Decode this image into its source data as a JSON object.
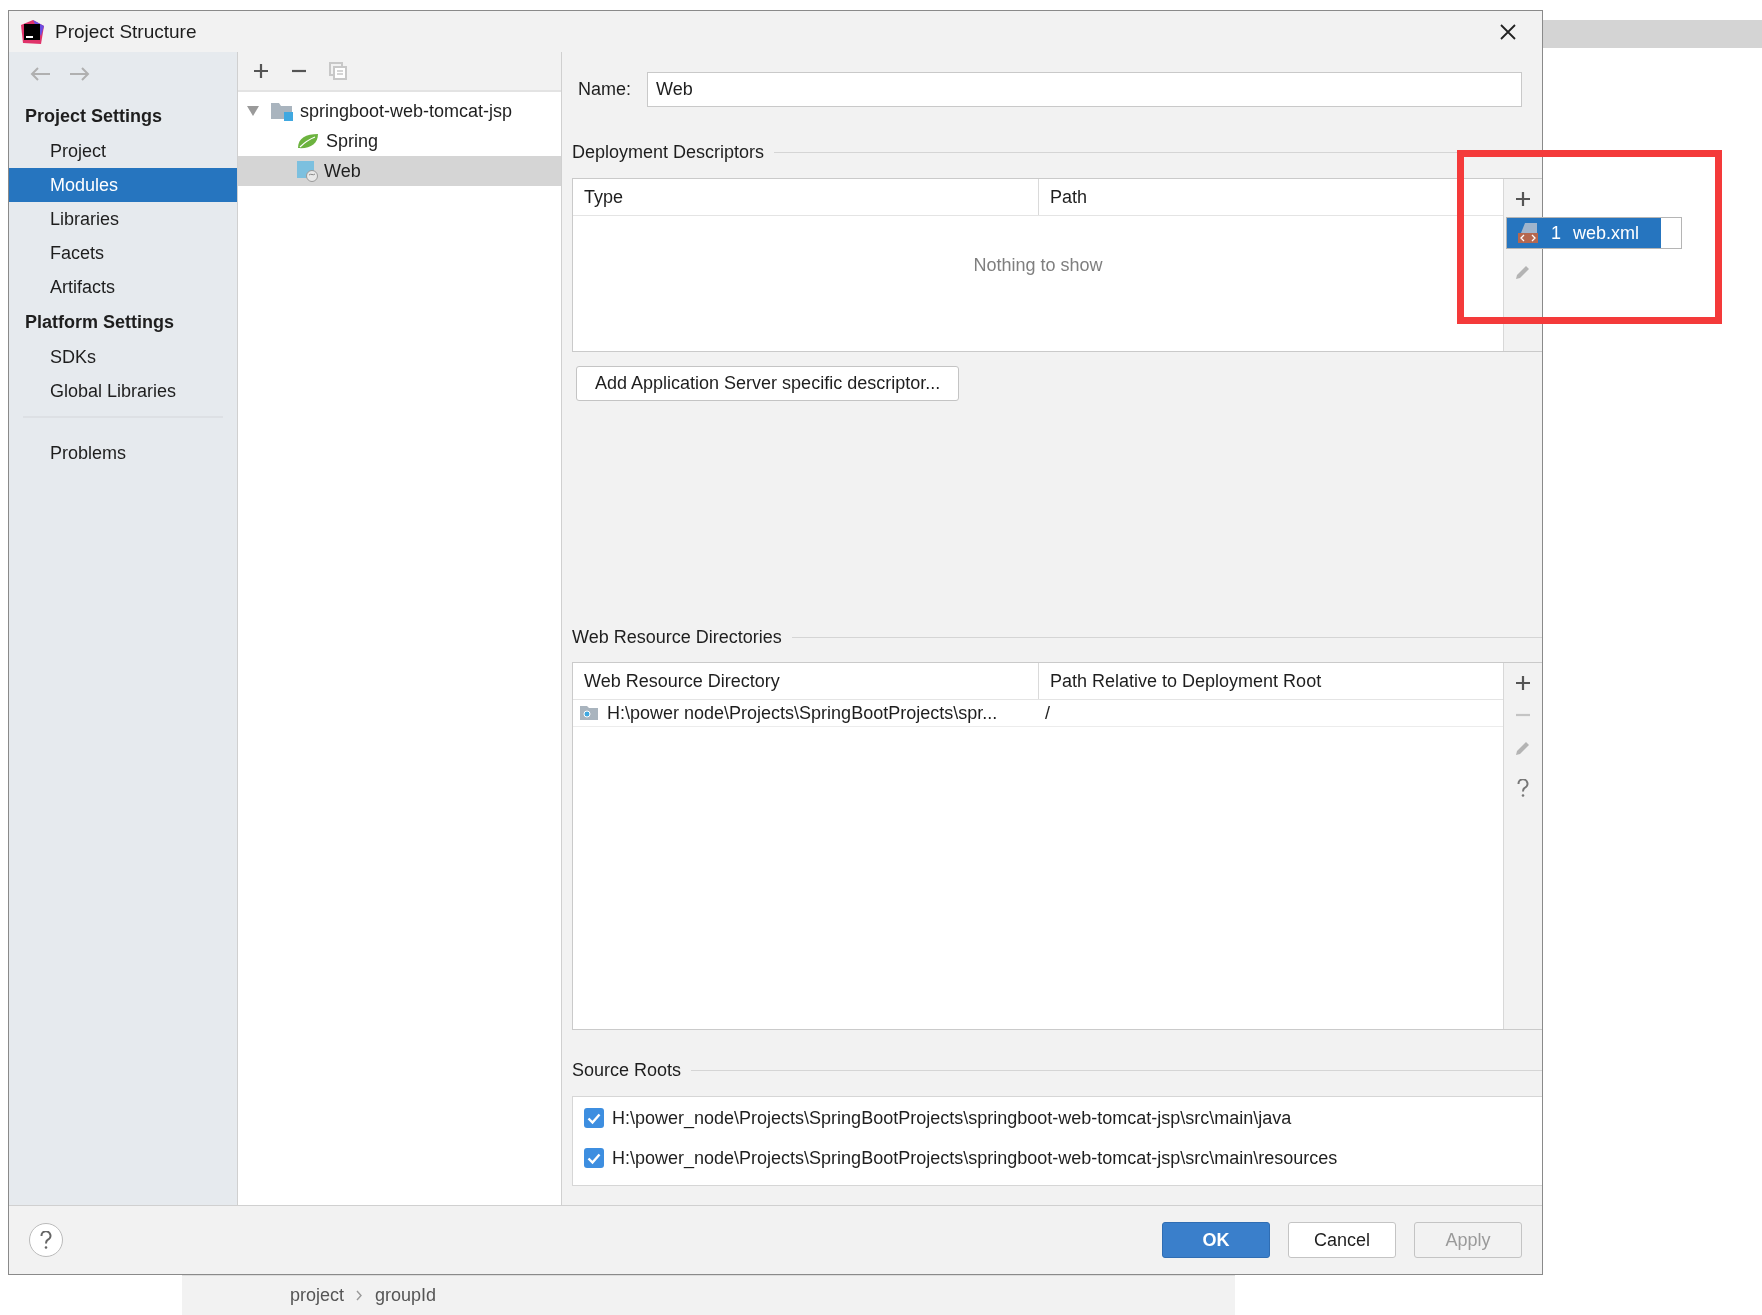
{
  "window": {
    "title": "Project Structure"
  },
  "sidebar": {
    "sections": [
      {
        "heading": "Project Settings",
        "items": [
          {
            "label": "Project",
            "selected": false
          },
          {
            "label": "Modules",
            "selected": true
          },
          {
            "label": "Libraries",
            "selected": false
          },
          {
            "label": "Facets",
            "selected": false
          },
          {
            "label": "Artifacts",
            "selected": false
          }
        ]
      },
      {
        "heading": "Platform Settings",
        "items": [
          {
            "label": "SDKs",
            "selected": false
          },
          {
            "label": "Global Libraries",
            "selected": false
          }
        ]
      }
    ],
    "bottom_items": [
      {
        "label": "Problems",
        "selected": false
      }
    ]
  },
  "tree": {
    "items": [
      {
        "label": "springboot-web-tomcat-jsp",
        "kind": "module",
        "expanded": true,
        "selected": false,
        "children": [
          {
            "label": "Spring",
            "kind": "spring",
            "selected": false
          },
          {
            "label": "Web",
            "kind": "web",
            "selected": true
          }
        ]
      }
    ]
  },
  "form": {
    "name_label": "Name:",
    "name_value": "Web"
  },
  "deployment_descriptors": {
    "title": "Deployment Descriptors",
    "columns": [
      "Type",
      "Path"
    ],
    "empty_text": "Nothing to show",
    "add_button": "Add Application Server specific descriptor..."
  },
  "popup": {
    "items": [
      {
        "number": "1",
        "label": "web.xml",
        "selected": true
      }
    ]
  },
  "web_resource_directories": {
    "title": "Web Resource Directories",
    "columns": [
      "Web Resource Directory",
      "Path Relative to Deployment Root"
    ],
    "rows": [
      {
        "directory": "H:\\power node\\Projects\\SpringBootProjects\\spr...",
        "path": "/"
      }
    ]
  },
  "source_roots": {
    "title": "Source Roots",
    "items": [
      {
        "path": "H:\\power_node\\Projects\\SpringBootProjects\\springboot-web-tomcat-jsp\\src\\main\\java",
        "checked": true
      },
      {
        "path": "H:\\power_node\\Projects\\SpringBootProjects\\springboot-web-tomcat-jsp\\src\\main\\resources",
        "checked": true
      }
    ]
  },
  "footer": {
    "buttons": [
      {
        "label": "OK",
        "kind": "primary",
        "disabled": false
      },
      {
        "label": "Cancel",
        "kind": "normal",
        "disabled": false
      },
      {
        "label": "Apply",
        "kind": "normal",
        "disabled": true
      }
    ]
  },
  "background": {
    "breadcrumb": [
      "project",
      "groupId"
    ]
  }
}
